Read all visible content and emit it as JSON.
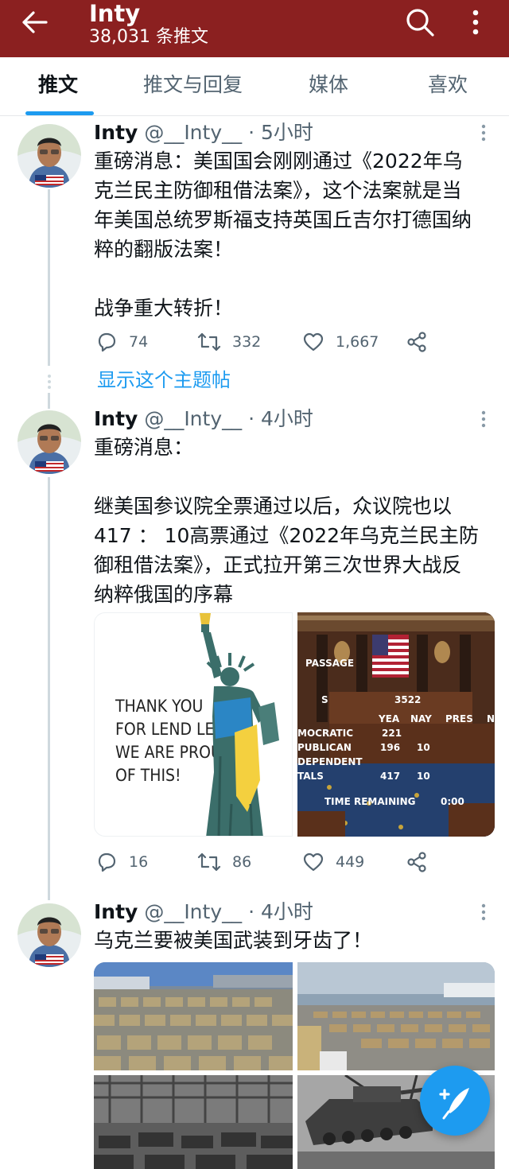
{
  "header": {
    "title": "Inty",
    "subtitle": "38,031 条推文",
    "back_icon": "arrow-left-icon",
    "search_icon": "search-icon",
    "more_icon": "more-vertical-icon",
    "bg_color": "#8b2020"
  },
  "tabs": [
    {
      "label": "推文",
      "active": true
    },
    {
      "label": "推文与回复",
      "active": false
    },
    {
      "label": "媒体",
      "active": false
    },
    {
      "label": "喜欢",
      "active": false
    }
  ],
  "tweets": [
    {
      "name": "Inty",
      "handle": "@__Inty__",
      "time": " · 5小时",
      "body": [
        "重磅消息：美国国会刚刚通过《2022年乌",
        "克兰民主防御租借法案》，这个法案就是当",
        "年美国总统罗斯福支持英国丘吉尔打德国纳",
        "粹的翻版法案！",
        "",
        "战争重大转折！"
      ],
      "replies": "74",
      "retweets": "332",
      "likes": "1,667"
    },
    {
      "name": "Inty",
      "handle": "@__Inty__",
      "time": " · 4小时",
      "body": [
        "重磅消息：",
        "",
        "继美国参议院全票通过以后，众议院也以",
        "417 ： 10高票通过《2022年乌克兰民主防",
        "御租借法案》，正式拉开第三次世界大战反",
        "纳粹俄国的序幕"
      ],
      "image1_text": [
        "THANK YOU",
        "FOR LEND LEASE",
        "WE ARE PROUD",
        "OF THIS!"
      ],
      "image2_text": {
        "passage": "PASSAGE",
        "s": "S",
        "bill": "3522",
        "yea": "YEA",
        "nay": "NAY",
        "pres": "PRES",
        "n": "N",
        "dem": "MOCRATIC",
        "dem_yea": "221",
        "rep": "PUBLICAN",
        "rep_yea": "196",
        "rep_nay": "10",
        "ind": "DEPENDENT",
        "tot": "TALS",
        "tot_yea": "417",
        "tot_nay": "10",
        "time_label": "TIME REMAINING",
        "time_value": "0:00"
      },
      "replies": "16",
      "retweets": "86",
      "likes": "449"
    },
    {
      "name": "Inty",
      "handle": "@__Inty__",
      "time": " · 4小时",
      "body": [
        "乌克兰要被美国武装到牙齿了！"
      ]
    }
  ],
  "show_thread": "显示这个主题帖",
  "fab_icon": "compose-feather-icon",
  "accent": "#1d9bf0"
}
